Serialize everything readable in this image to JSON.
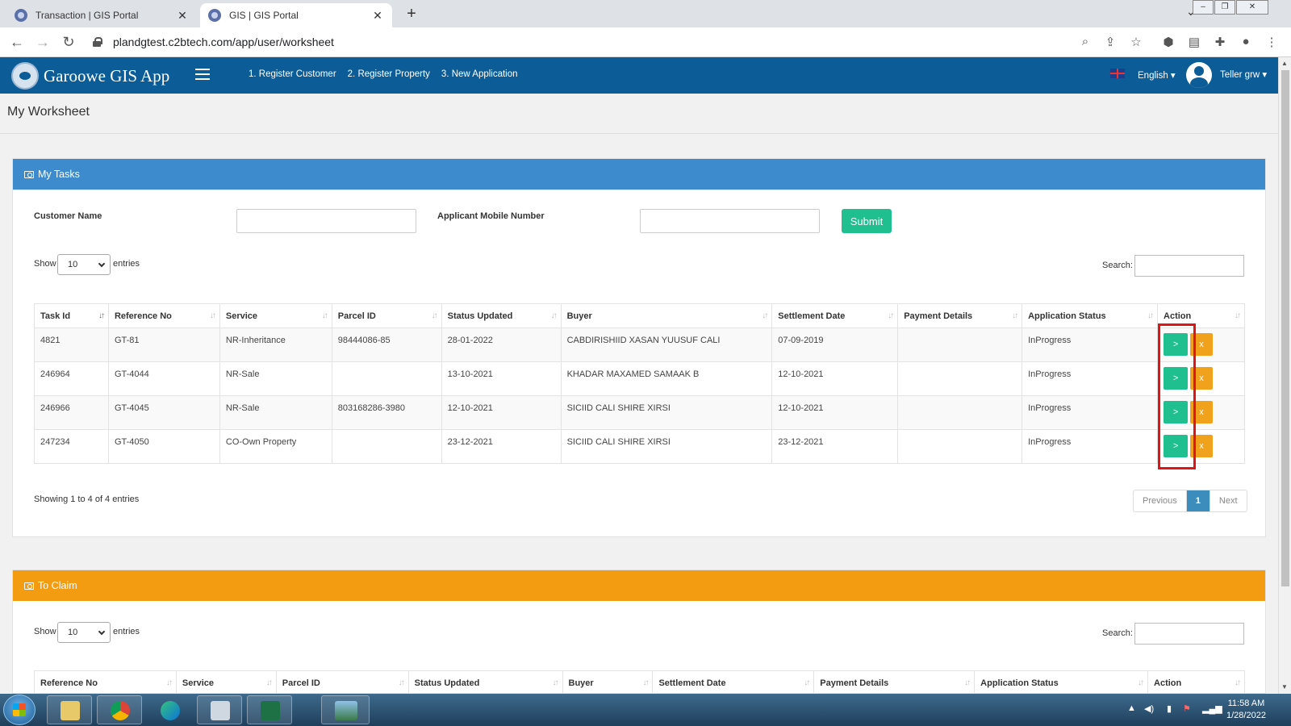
{
  "browser": {
    "tabs": [
      {
        "title": "Transaction | GIS Portal",
        "active": false
      },
      {
        "title": "GIS | GIS Portal",
        "active": true
      }
    ],
    "new_tab": "+",
    "tab_close": "✕",
    "url": "plandgtest.c2btech.com/app/user/worksheet"
  },
  "header": {
    "app_title": "Garoowe GIS App",
    "nav": [
      "1. Register Customer",
      "2. Register Property",
      "3. New Application"
    ],
    "language": "English ▾",
    "user": "Teller grw ▾"
  },
  "page_title": "My Worksheet",
  "my_tasks": {
    "title": "My Tasks",
    "header_color": "#3d8bcd",
    "customer_name_label": "Customer Name",
    "mobile_label": "Applicant Mobile Number",
    "submit_label": "Submit",
    "show_label": "Show",
    "entries_label": "entries",
    "page_length": "10",
    "search_label": "Search:",
    "columns": [
      "Task Id",
      "Reference No",
      "Service",
      "Parcel ID",
      "Status Updated",
      "Buyer",
      "Settlement Date",
      "Payment Details",
      "Application Status",
      "Action"
    ],
    "rows": [
      {
        "task_id": "4821",
        "ref": "GT-81",
        "service": "NR-Inheritance",
        "parcel": "98444086-85",
        "status_updated": "28-01-2022",
        "buyer": "CABDIRISHIID XASAN YUUSUF CALI",
        "settlement": "07-09-2019",
        "payment": "",
        "app_status": "InProgress"
      },
      {
        "task_id": "246964",
        "ref": "GT-4044",
        "service": "NR-Sale",
        "parcel": "",
        "status_updated": "13-10-2021",
        "buyer": "KHADAR MAXAMED SAMAAK B",
        "settlement": "12-10-2021",
        "payment": "",
        "app_status": "InProgress"
      },
      {
        "task_id": "246966",
        "ref": "GT-4045",
        "service": "NR-Sale",
        "parcel": "803168286-3980",
        "status_updated": "12-10-2021",
        "buyer": "SICIID CALI SHIRE XIRSI",
        "settlement": "12-10-2021",
        "payment": "",
        "app_status": "InProgress"
      },
      {
        "task_id": "247234",
        "ref": "GT-4050",
        "service": "CO-Own Property",
        "parcel": "",
        "status_updated": "23-12-2021",
        "buyer": "SICIID CALI SHIRE XIRSI",
        "settlement": "23-12-2021",
        "payment": "",
        "app_status": "InProgress"
      }
    ],
    "action_go": ">",
    "action_remove": "x",
    "info": "Showing 1 to 4 of 4 entries",
    "pager": {
      "previous": "Previous",
      "current": "1",
      "next": "Next"
    }
  },
  "to_claim": {
    "title": "To Claim",
    "header_color": "#f39c12",
    "show_label": "Show",
    "entries_label": "entries",
    "page_length": "10",
    "search_label": "Search:",
    "columns": [
      "Reference No",
      "Service",
      "Parcel ID",
      "Status Updated",
      "Buyer",
      "Settlement Date",
      "Payment Details",
      "Application Status",
      "Action"
    ]
  },
  "taskbar": {
    "time": "11:58 AM",
    "date": "1/28/2022"
  }
}
